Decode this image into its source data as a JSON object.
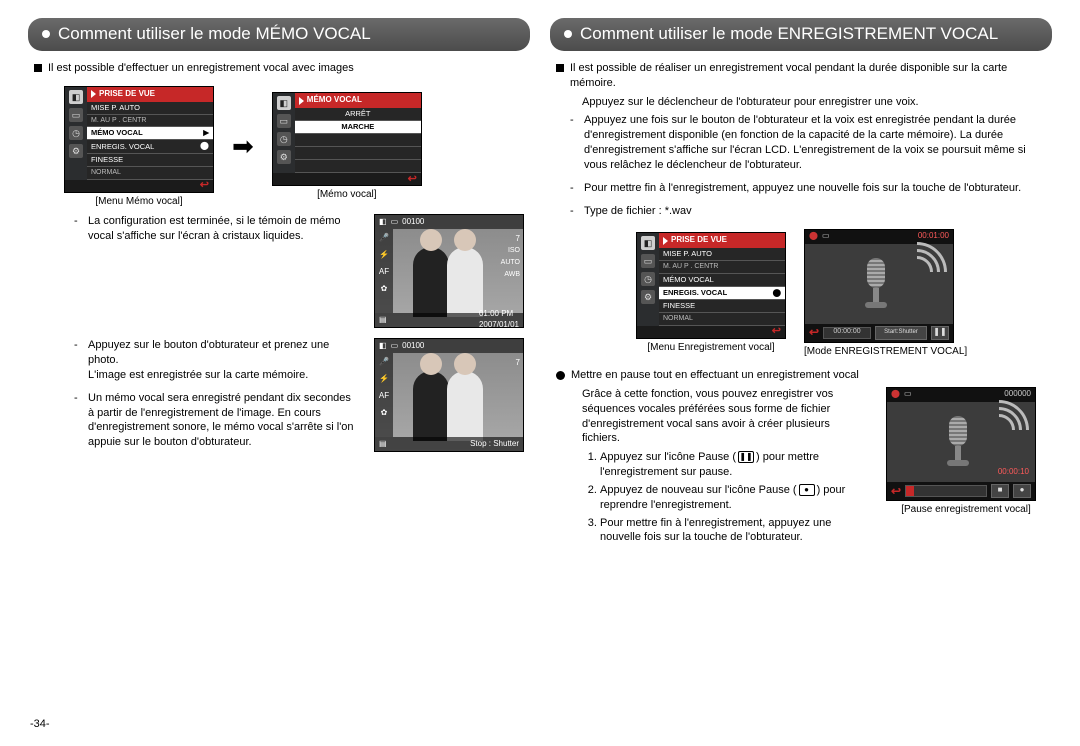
{
  "left": {
    "title": "Comment utiliser le mode MÉMO VOCAL",
    "intro": "Il est possible d'effectuer un enregistrement vocal avec images",
    "menu1": {
      "header": "PRISE DE VUE",
      "r1a": "MISE P. AUTO",
      "r1b": "M. AU P . CENTR",
      "r2": "MÉMO VOCAL",
      "r3": "ENREGIS. VOCAL",
      "r4a": "FINESSE",
      "r4b": "NORMAL",
      "caption": "[Menu Mémo vocal]"
    },
    "menu2": {
      "header": "MÉMO VOCAL",
      "r1": "ARRÊT",
      "r2": "MARCHE",
      "caption": "[Mémo vocal]"
    },
    "note1": "La configuration est terminée, si le témoin de mémo vocal s'affiche sur l'écran à cristaux liquides.",
    "photo1": {
      "count": "00100",
      "iso": "ISO\nAUTO\nAWB",
      "time": "01:00 PM",
      "date": "2007/01/01",
      "seven": "7"
    },
    "note2a": "Appuyez sur le bouton d'obturateur et prenez une photo.",
    "note2b": "L'image est enregistrée sur la carte mémoire.",
    "note3": "Un mémo vocal sera enregistré pendant dix secondes à partir de l'enregistrement de l'image. En cours d'enregistrement sonore, le mémo vocal s'arrête si l'on appuie sur le bouton d'obturateur.",
    "photo2": {
      "count": "00100",
      "stop": "Stop : Shutter",
      "seven": "7"
    }
  },
  "right": {
    "title": "Comment utiliser le mode ENREGISTREMENT VOCAL",
    "intro": "Il est possible de réaliser un enregistrement vocal pendant la durée disponible sur la carte mémoire.",
    "sub": "Appuyez sur le déclencheur de l'obturateur pour enregistrer une voix.",
    "b1": "Appuyez une fois sur le bouton de l'obturateur et la voix est enregistrée pendant la durée d'enregistrement disponible (en fonction de la capacité de la carte mémoire). La durée d'enregistrement s'affiche sur l'écran LCD. L'enregistrement de la voix se poursuit même si vous relâchez le déclencheur de l'obturateur.",
    "b2": "Pour mettre fin à l'enregistrement, appuyez une nouvelle fois sur la touche de l'obturateur.",
    "b3": "Type de fichier : *.wav",
    "menu": {
      "header": "PRISE DE VUE",
      "r1a": "MISE P. AUTO",
      "r1b": "M. AU P . CENTR",
      "r2": "MÉMO VOCAL",
      "r3": "ENREGIS. VOCAL",
      "r4a": "FINESSE",
      "r4b": "NORMAL",
      "caption": "[Menu Enregistrement vocal]"
    },
    "rec": {
      "top": "00:01:00",
      "bar": "00:00:00",
      "btn": "Start:Shutter",
      "caption": "[Mode ENREGISTREMENT VOCAL]"
    },
    "pause_title": "Mettre en pause tout en effectuant un enregistrement vocal",
    "pause_desc": "Grâce à cette fonction, vous pouvez enregistrer vos séquences vocales préférées sous forme de fichier d'enregistrement vocal sans avoir à créer plusieurs fichiers.",
    "s1a": "Appuyez sur l'icône Pause (",
    "s1b": ") pour mettre l'enregistrement sur pause.",
    "s2a": "Appuyez de nouveau sur l'icône Pause (",
    "s2b": ") pour reprendre l'enregistrement.",
    "s3": "Pour mettre fin à l'enregistrement, appuyez une nouvelle fois sur la touche de l'obturateur.",
    "pause": {
      "top": "000000",
      "time": "00:00:10",
      "caption": "[Pause enregistrement vocal]"
    }
  },
  "pagenum": "-34-"
}
